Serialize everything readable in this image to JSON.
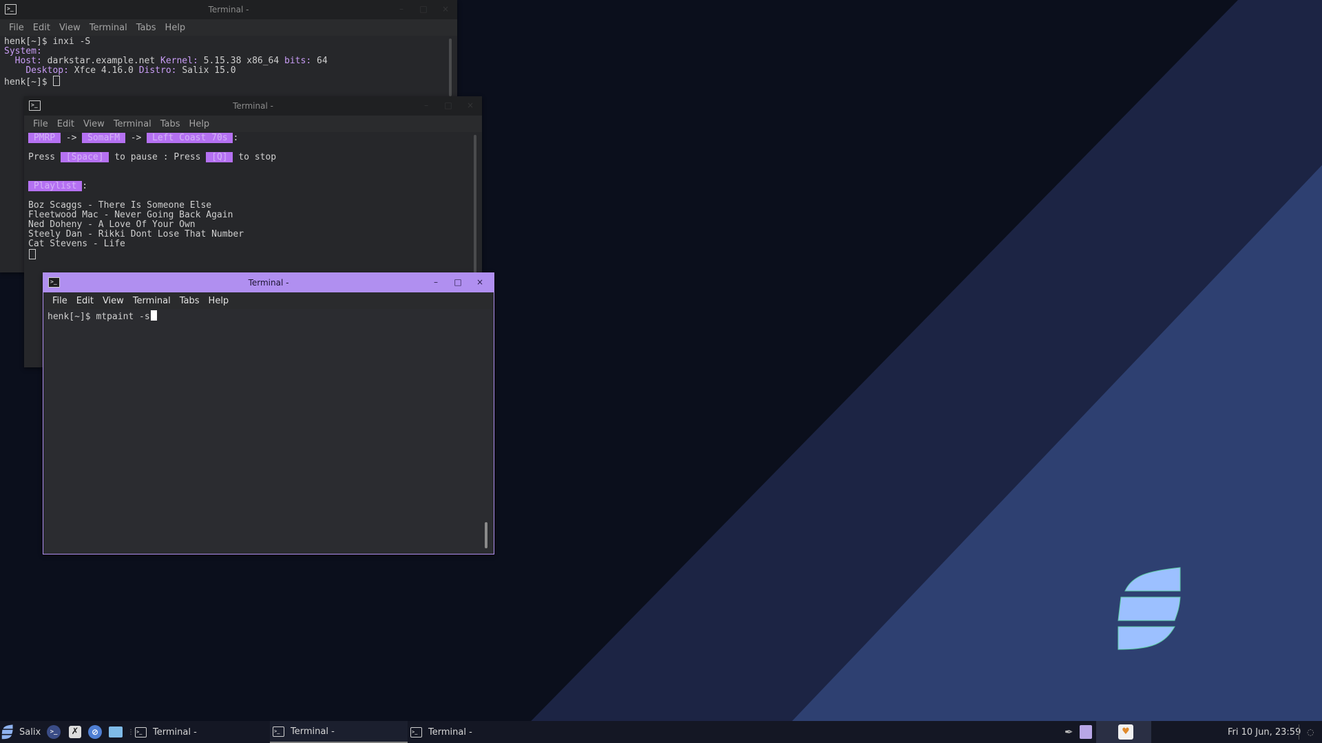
{
  "colors": {
    "accent": "#b08ff0",
    "highlight": "#b571f2",
    "wallpaper_dark": "#0b0f1c",
    "wallpaper_mid": "#1c2444",
    "wallpaper_light": "#2e4071",
    "logo": "#9cc0ff",
    "taskbar": "#141724"
  },
  "menu": [
    "File",
    "Edit",
    "View",
    "Terminal",
    "Tabs",
    "Help"
  ],
  "window_controls": {
    "minimize": "–",
    "maximize": "□",
    "close": "×"
  },
  "term1": {
    "title": "Terminal -",
    "prompt1": "henk[~]$ inxi -S",
    "system_label": "System:",
    "host_label": "Host:",
    "host_value": "darkstar.example.net",
    "kernel_label": "Kernel:",
    "kernel_value": "5.15.38 x86_64",
    "bits_label": "bits:",
    "bits_value": "64",
    "desktop_label": "Desktop:",
    "desktop_value": "Xfce 4.16.0",
    "distro_label": "Distro:",
    "distro_value": "Salix 15.0",
    "prompt2": "henk[~]$"
  },
  "term2": {
    "title": "Terminal -",
    "crumb1": " PMRP ",
    "arrow": " -> ",
    "crumb2": " SomaFM ",
    "crumb3": " Left Coast 70s ",
    "colon": ":",
    "press1": "Press ",
    "space_key": " [Space] ",
    "to_pause": " to pause : Press ",
    "q_key": " [Q] ",
    "to_stop": " to stop",
    "playlist_label": " Playlist ",
    "playlist": [
      "Boz Scaggs - There Is Someone Else",
      "Fleetwood Mac - Never Going Back Again",
      "Ned Doheny - A Love Of Your Own",
      "Steely Dan - Rikki Dont Lose That Number",
      "Cat Stevens - Life"
    ]
  },
  "term3": {
    "title": "Terminal -",
    "prompt": "henk[~]$ mtpaint -s"
  },
  "taskbar": {
    "start_label": "Salix",
    "tasks": [
      "Terminal -",
      "Terminal -",
      "Terminal -"
    ],
    "clock": "Fri 10 Jun, 23:59",
    "launchers": [
      "terminal-icon",
      "tools-icon",
      "browser-icon",
      "folder-icon"
    ]
  }
}
